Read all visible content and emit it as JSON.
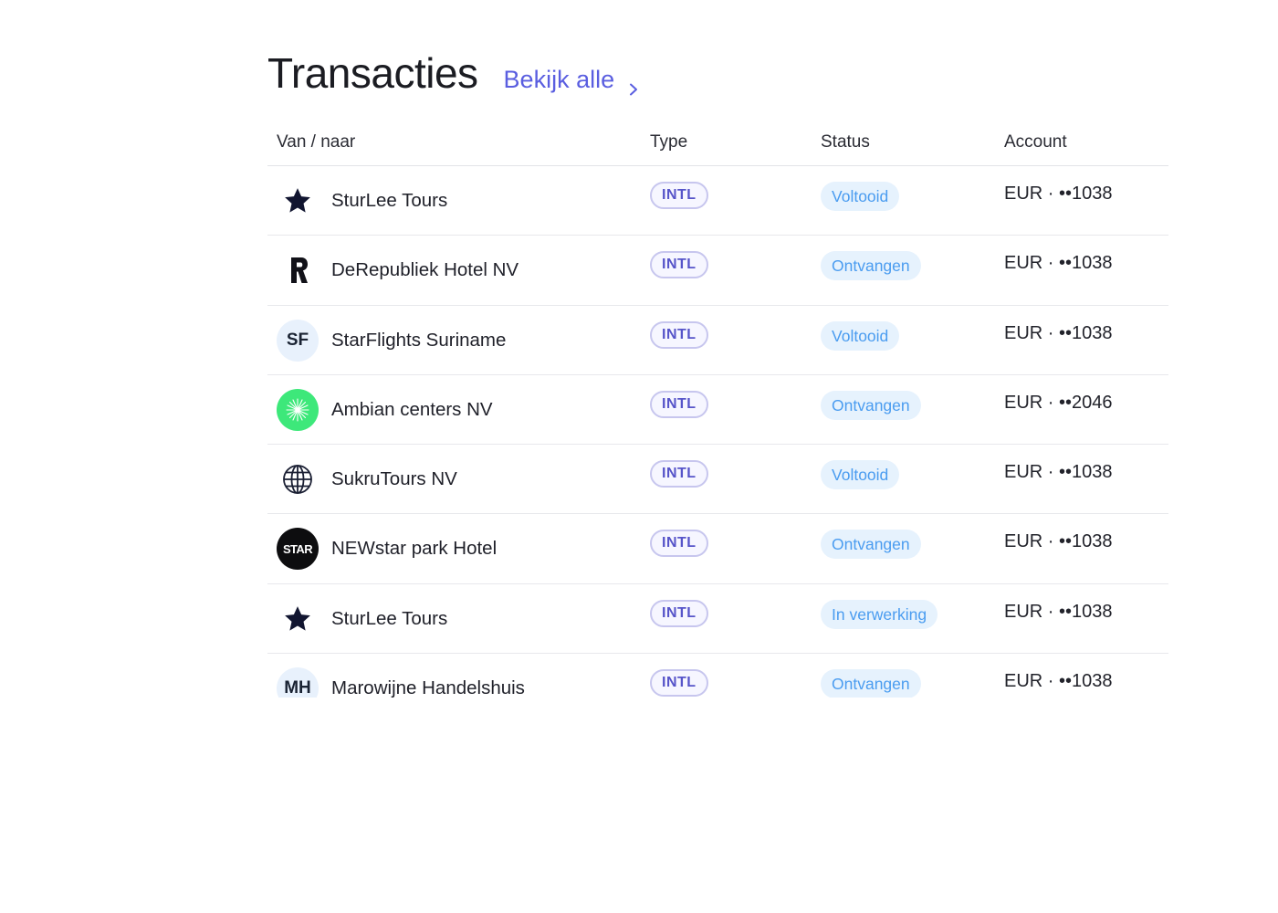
{
  "header": {
    "title": "Transacties",
    "see_all": "Bekijk alle"
  },
  "columns": {
    "name": "Van / naar",
    "type": "Type",
    "status": "Status",
    "account": "Account"
  },
  "rows": [
    {
      "avatar": "star-icon",
      "name": "SturLee Tours",
      "type": "INTL",
      "status": "Voltooid",
      "account": "EUR · ••1038"
    },
    {
      "avatar": "letter-r-logo",
      "name": "DeRepubliek Hotel NV",
      "type": "INTL",
      "status": "Ontvangen",
      "account": "EUR · ••1038"
    },
    {
      "avatar": "initials",
      "initials": "SF",
      "name": "StarFlights Suriname",
      "type": "INTL",
      "status": "Voltooid",
      "account": "EUR · ••1038"
    },
    {
      "avatar": "green-compass-logo",
      "name": "Ambian centers NV",
      "type": "INTL",
      "status": "Ontvangen",
      "account": "EUR · ••2046"
    },
    {
      "avatar": "globe-icon",
      "name": "SukruTours NV",
      "type": "INTL",
      "status": "Voltooid",
      "account": "EUR · ••1038"
    },
    {
      "avatar": "star-logo",
      "logo_text": "STAR",
      "name": "NEWstar park Hotel",
      "type": "INTL",
      "status": "Ontvangen",
      "account": "EUR · ••1038"
    },
    {
      "avatar": "star-icon",
      "name": "SturLee Tours",
      "type": "INTL",
      "status": "In verwerking",
      "account": "EUR · ••1038"
    },
    {
      "avatar": "initials",
      "initials": "MH",
      "name": "Marowijne Handelshuis",
      "type": "INTL",
      "status": "Ontvangen",
      "account": "EUR · ••1038"
    }
  ],
  "colors": {
    "accent": "#5a5ee0",
    "status_bg": "#e6f2fd",
    "status_text": "#4a9cf0",
    "type_border": "#c7c6ee",
    "type_text": "#5654c9"
  }
}
